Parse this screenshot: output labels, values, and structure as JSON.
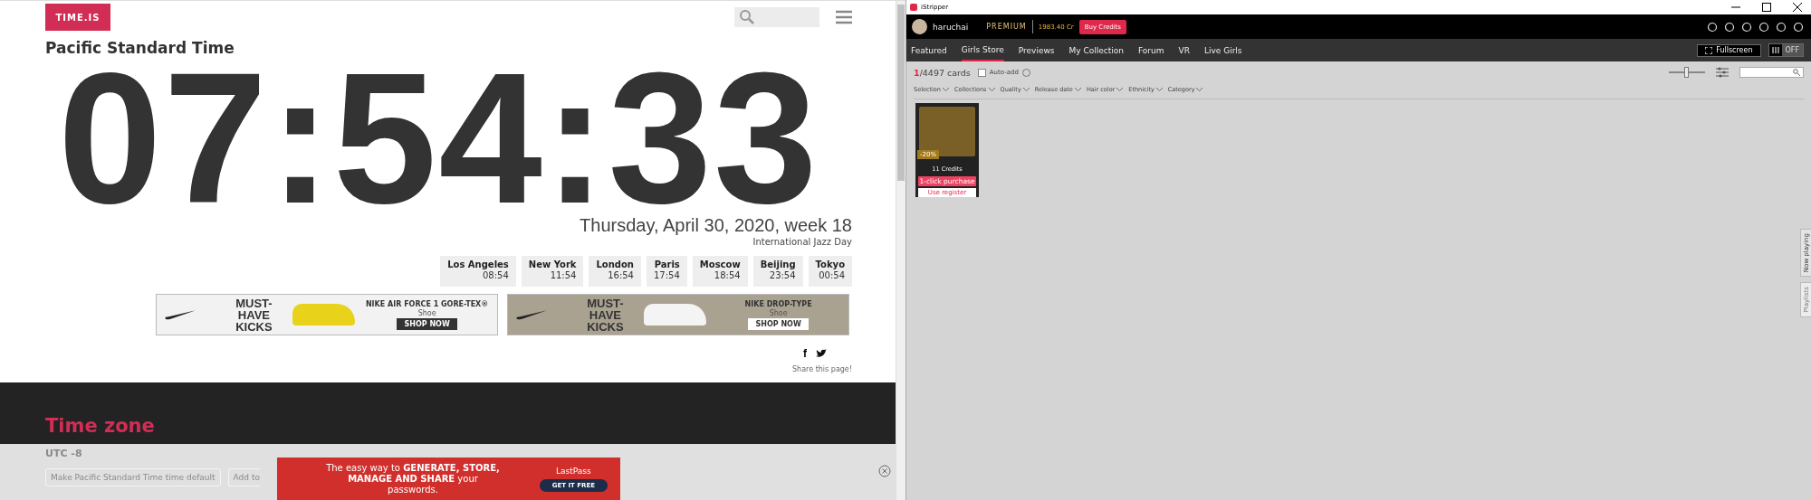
{
  "browser": {
    "logo": "TIME.IS",
    "zone_title": "Pacific Standard Time",
    "clock": "07:54:33",
    "date": "Thursday, April 30, 2020, week 18",
    "holiday": "International Jazz Day",
    "cities": [
      {
        "name": "Los Angeles",
        "time": "08:54"
      },
      {
        "name": "New York",
        "time": "11:54"
      },
      {
        "name": "London",
        "time": "16:54"
      },
      {
        "name": "Paris",
        "time": "17:54"
      },
      {
        "name": "Moscow",
        "time": "18:54"
      },
      {
        "name": "Beijing",
        "time": "23:54"
      },
      {
        "name": "Tokyo",
        "time": "00:54"
      }
    ],
    "ads": [
      {
        "headline": "MUST-HAVE KICKS",
        "product": "NIKE AIR FORCE 1 GORE-TEX®",
        "category": "Shoe",
        "cta": "SHOP NOW",
        "kind": "light"
      },
      {
        "headline": "MUST-HAVE KICKS",
        "product": "NIKE DROP-TYPE",
        "category": "Shoe",
        "cta": "SHOP NOW",
        "kind": "tan"
      }
    ],
    "share": "Share this page!",
    "share_glyph": "f",
    "section_title": "Time zone",
    "utc": "UTC -8",
    "actions": [
      "Make Pacific Standard Time time default",
      "Add to"
    ],
    "bottom_ad": {
      "text": "The easy way to **GENERATE, STORE,** **MANAGE AND SHARE** your passwords.",
      "brand": "LastPass",
      "cta": "GET IT FREE"
    }
  },
  "app": {
    "window_title": "iStripper",
    "user": "haruchai",
    "tier": "PREMIUM",
    "credits": "1983.40 Cr",
    "buy": "Buy Credits",
    "tabs": [
      {
        "label": "Featured",
        "selected": false
      },
      {
        "label": "Girls Store",
        "selected": true
      },
      {
        "label": "Previews",
        "selected": false
      },
      {
        "label": "My Collection",
        "selected": false
      },
      {
        "label": "Forum",
        "selected": false
      },
      {
        "label": "VR",
        "selected": false
      },
      {
        "label": "Live Girls",
        "selected": false
      }
    ],
    "fullscreen": "Fullscreen",
    "toggle": {
      "label": "OFF",
      "on": false
    },
    "count": "1",
    "total": "/4497 cards",
    "auto_add": {
      "label": "Auto-add",
      "checked": false
    },
    "zoom": {
      "level": 0.5
    },
    "filters": [
      "Selection",
      "Collections",
      "Quality",
      "Release date",
      "Hair color",
      "Ethnicity",
      "Category"
    ],
    "cards": [
      {
        "discount": "-20%",
        "price": "11 Credits",
        "buy": "1-click purchase",
        "secondary": "Use register"
      }
    ],
    "side_tabs": [
      {
        "label": "Now playing",
        "disabled": false
      },
      {
        "label": "Playlists",
        "disabled": true
      }
    ]
  }
}
